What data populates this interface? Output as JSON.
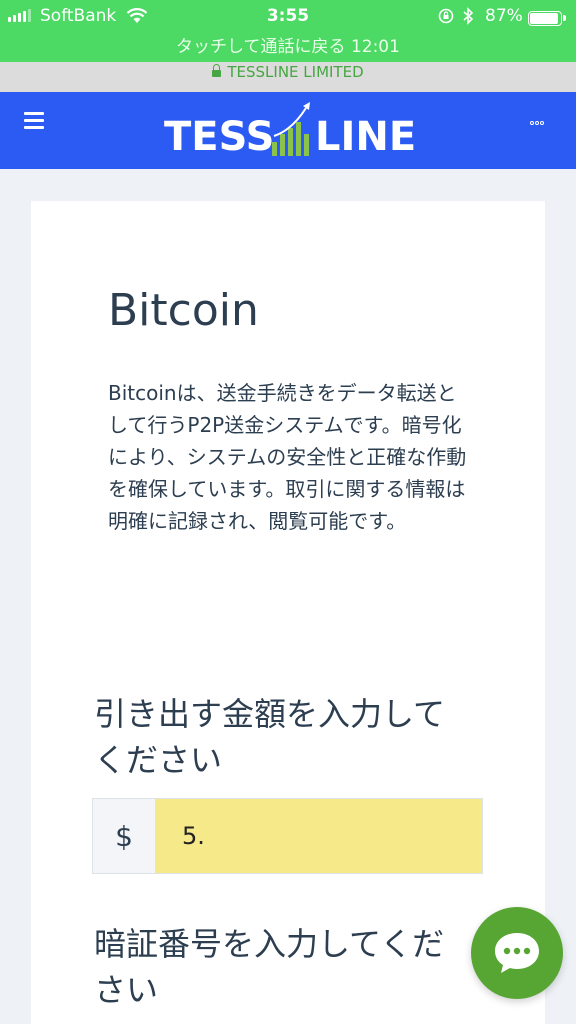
{
  "status_bar": {
    "carrier": "SoftBank",
    "time": "3:55",
    "battery": "87%",
    "battery_level": 0.87,
    "call_banner": "タッチして通話に戻る 12:01"
  },
  "url_bar": {
    "site": "TESSLINE LIMITED"
  },
  "header": {
    "logo_left": "TESS",
    "logo_right": "LINE"
  },
  "content": {
    "title": "Bitcoin",
    "description": "Bitcoinは、送金手続きをデータ転送として行うP2P送金システムです。暗号化により、システムの安全性と正確な作動を確保しています。取引に関する情報は明確に記録され、閲覧可能です。",
    "amount_label": "引き出す金額を入力してください",
    "currency_symbol": "$",
    "amount_value": "5.",
    "pin_label": "暗証番号を入力してください"
  },
  "colors": {
    "status_green": "#4cd964",
    "header_blue": "#2c5bf3",
    "input_highlight": "#f6e98a",
    "chat_green": "#57a634"
  }
}
